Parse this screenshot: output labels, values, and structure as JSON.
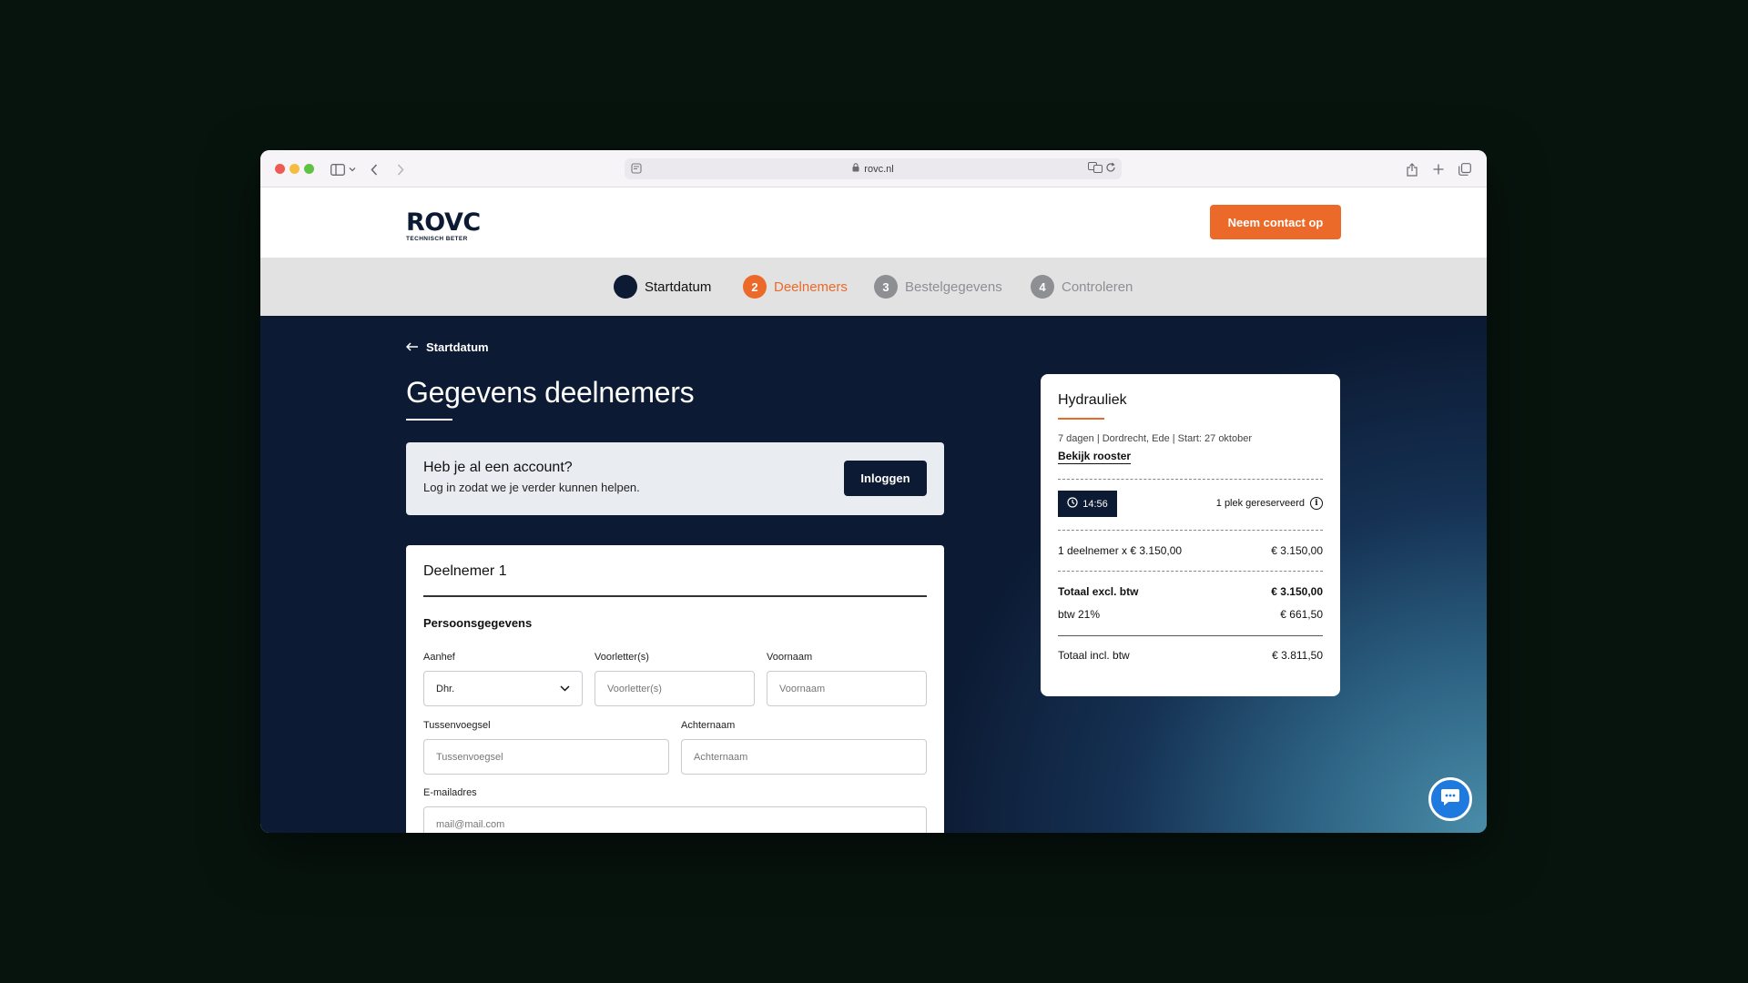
{
  "browser": {
    "url": "rovc.nl"
  },
  "header": {
    "logo_main": "ROVC",
    "logo_sub": "TECHNISCH BETER",
    "contact_label": "Neem contact op"
  },
  "steps": [
    {
      "num": "1",
      "label": "Startdatum",
      "state": "done"
    },
    {
      "num": "2",
      "label": "Deelnemers",
      "state": "active"
    },
    {
      "num": "3",
      "label": "Bestelgegevens",
      "state": "todo"
    },
    {
      "num": "4",
      "label": "Controleren",
      "state": "todo"
    }
  ],
  "main": {
    "back_label": "Startdatum",
    "title": "Gegevens deelnemers",
    "account": {
      "title": "Heb je al een account?",
      "subtitle": "Log in zodat we je verder kunnen helpen.",
      "login_label": "Inloggen"
    },
    "participant": {
      "title": "Deelnemer 1",
      "section": "Persoonsgegevens",
      "fields": {
        "aanhef_label": "Aanhef",
        "aanhef_value": "Dhr.",
        "voorletters_label": "Voorletter(s)",
        "voorletters_placeholder": "Voorletter(s)",
        "voornaam_label": "Voornaam",
        "voornaam_placeholder": "Voornaam",
        "tussenvoegsel_label": "Tussenvoegsel",
        "tussenvoegsel_placeholder": "Tussenvoegsel",
        "achternaam_label": "Achternaam",
        "achternaam_placeholder": "Achternaam",
        "email_label": "E-mailadres",
        "email_placeholder": "mail@mail.com"
      }
    }
  },
  "summary": {
    "title": "Hydrauliek",
    "meta": "7 dagen | Dordrecht, Ede | Start: 27 oktober",
    "schedule_link": "Bekijk rooster",
    "timer": "14:56",
    "reserved": "1 plek gereserveerd",
    "line_item_label": "1 deelnemer x € 3.150,00",
    "line_item_value": "€ 3.150,00",
    "total_excl_label": "Totaal excl. btw",
    "total_excl_value": "€ 3.150,00",
    "vat_label": "btw 21%",
    "vat_value": "€ 661,50",
    "total_incl_label": "Totaal incl. btw",
    "total_incl_value": "€ 3.811,50"
  },
  "colors": {
    "brand_orange": "#eb6a2a",
    "brand_navy": "#0c1a33",
    "chat_blue": "#1f7ae0"
  }
}
